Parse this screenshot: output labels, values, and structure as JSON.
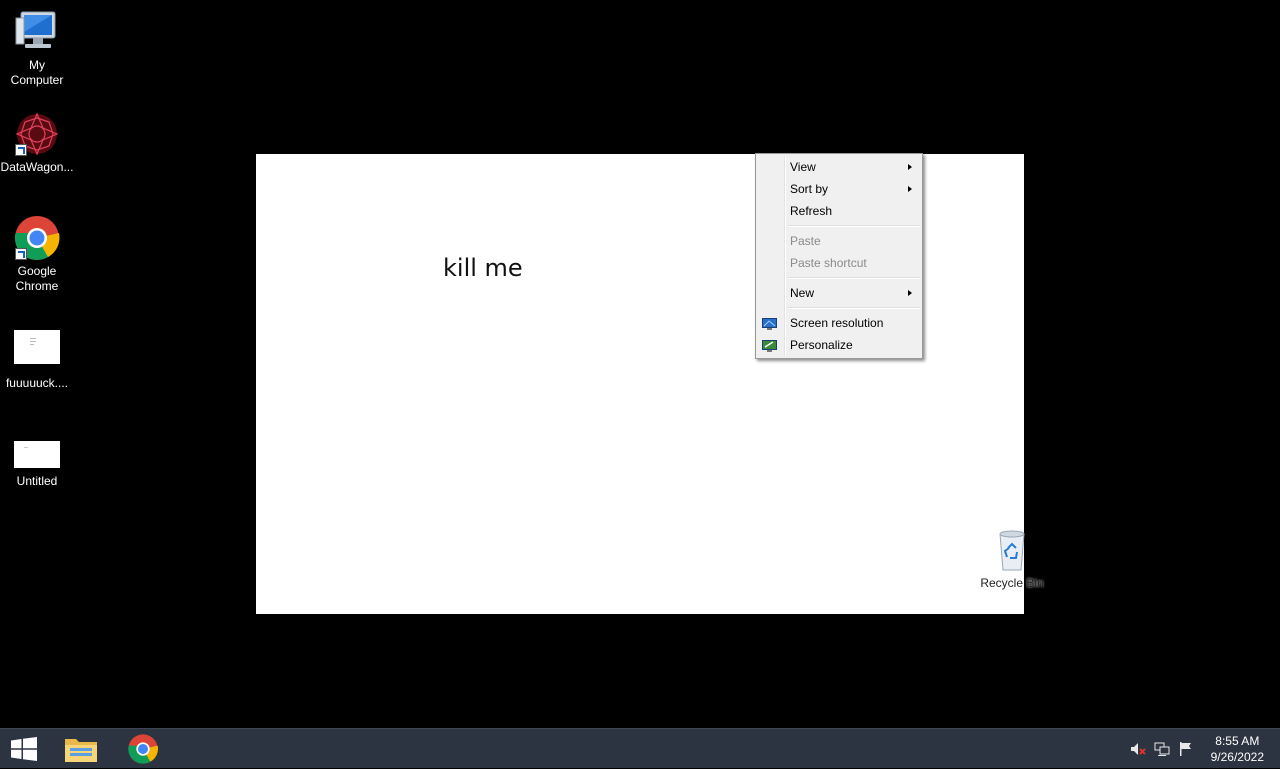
{
  "desktop": {
    "icons": [
      {
        "label": "My\nComputer",
        "line1": "My",
        "line2": "Computer",
        "icon": "computer-icon"
      },
      {
        "label": "DataWagon...",
        "icon": "datawagon-icon"
      },
      {
        "label": "Google Chrome",
        "line1": "Google",
        "line2": "Chrome",
        "icon": "chrome-icon"
      },
      {
        "label": "fuuuuuck....",
        "icon": "document-thumbnail-icon"
      },
      {
        "label": "Untitled",
        "icon": "document-thumbnail-icon"
      },
      {
        "label": "Recycle Bin",
        "icon": "recycle-bin-icon"
      }
    ],
    "wallpaper_text": "kill me"
  },
  "context_menu": {
    "items": [
      {
        "label": "View",
        "submenu": true,
        "enabled": true
      },
      {
        "label": "Sort by",
        "submenu": true,
        "enabled": true
      },
      {
        "label": "Refresh",
        "submenu": false,
        "enabled": true
      },
      {
        "label": "Paste",
        "submenu": false,
        "enabled": false
      },
      {
        "label": "Paste shortcut",
        "submenu": false,
        "enabled": false
      },
      {
        "label": "New",
        "submenu": true,
        "enabled": true
      },
      {
        "label": "Screen resolution",
        "submenu": false,
        "enabled": true,
        "icon": "screen-resolution-icon"
      },
      {
        "label": "Personalize",
        "submenu": false,
        "enabled": true,
        "icon": "personalize-icon"
      }
    ]
  },
  "taskbar": {
    "start_icon": "windows-logo-icon",
    "pinned": [
      "file-explorer-icon",
      "chrome-icon"
    ],
    "tray": [
      "volume-muted-icon",
      "network-icon",
      "action-center-flag-icon"
    ],
    "clock": {
      "time": "8:55 AM",
      "date": "9/26/2022"
    }
  },
  "colors": {
    "desktop_bg": "#000000",
    "wallpaper": "#ffffff",
    "taskbar": "#2b3440",
    "menu_bg": "#f0f0f0"
  }
}
